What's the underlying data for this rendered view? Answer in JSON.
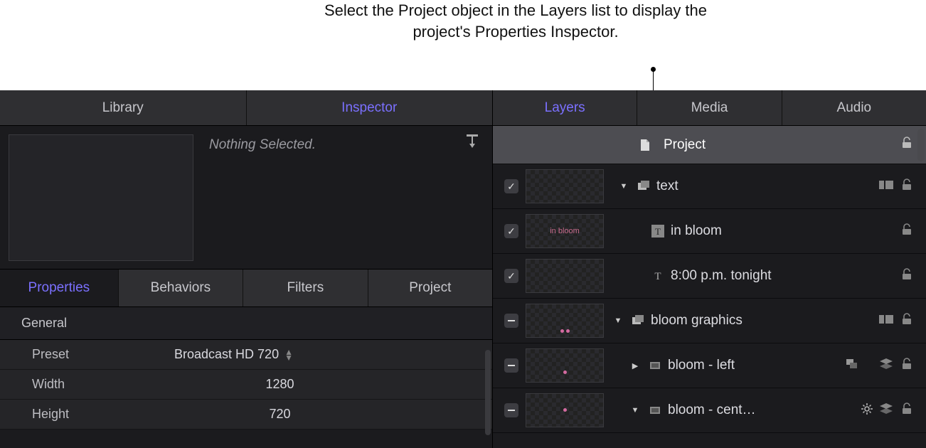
{
  "callout_text": "Select the Project object in the Layers list to display the project's Properties Inspector.",
  "left_tabs": {
    "library": "Library",
    "inspector": "Inspector"
  },
  "preview_status": "Nothing Selected.",
  "sub_tabs": {
    "properties": "Properties",
    "behaviors": "Behaviors",
    "filters": "Filters",
    "project": "Project"
  },
  "properties": {
    "section": "General",
    "preset_label": "Preset",
    "preset_value": "Broadcast HD 720",
    "width_label": "Width",
    "width_value": "1280",
    "height_label": "Height",
    "height_value": "720"
  },
  "right_tabs": {
    "layers": "Layers",
    "media": "Media",
    "audio": "Audio"
  },
  "layers": {
    "project": "Project",
    "items": [
      {
        "name": "text",
        "check": "check",
        "kind": "group",
        "expanded": true,
        "thumb_text": ""
      },
      {
        "name": "in bloom",
        "check": "check",
        "kind": "text-solid",
        "thumb_text": "in bloom",
        "indent": 2
      },
      {
        "name": "8:00 p.m. tonight",
        "check": "check",
        "kind": "text-outline",
        "thumb_text": "",
        "indent": 2
      },
      {
        "name": "bloom graphics",
        "check": "minus",
        "kind": "group",
        "expanded": true,
        "thumb_text": ""
      },
      {
        "name": "bloom - left",
        "check": "minus",
        "kind": "layer",
        "expanded": false,
        "thumb_text": "",
        "has_clone": true,
        "has_stacks": true,
        "indent": 2
      },
      {
        "name": "bloom - cent…",
        "check": "minus",
        "kind": "layer",
        "expanded": true,
        "thumb_text": "",
        "has_gear": true,
        "has_stacks": true,
        "indent": 2
      }
    ]
  }
}
